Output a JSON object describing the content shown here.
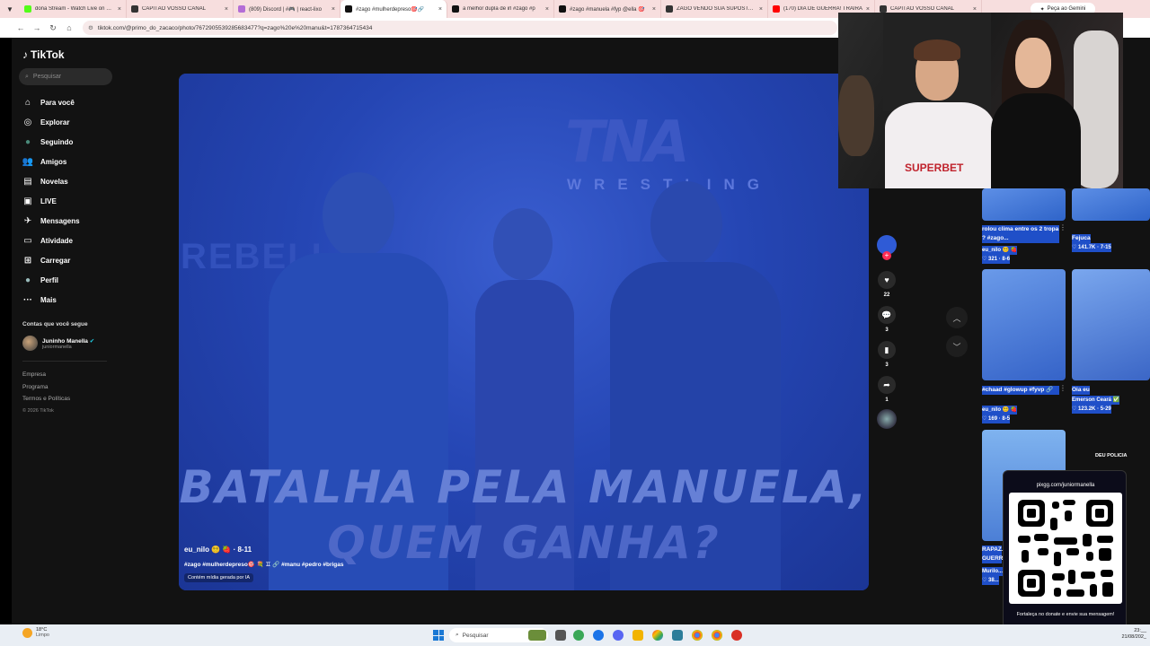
{
  "browser": {
    "tabs": [
      {
        "label": "dona Stream - Watch Live on K...",
        "color": "#53fc18",
        "active": false
      },
      {
        "label": "CAPITÃO VOSSO CANAL",
        "color": "#333333",
        "active": false
      },
      {
        "label": "(809) Discord | #🎮 | react-lixo",
        "color": "#b46dd6",
        "active": false
      },
      {
        "label": "#zago #mulherdepreso🎯🔗",
        "color": "#111111",
        "active": true
      },
      {
        "label": "a melhor dupla de irl #zago #p",
        "color": "#111111",
        "active": false
      },
      {
        "label": "#zago #manuela #fyp @ella 🎯",
        "color": "#111111",
        "active": false
      },
      {
        "label": "ZAGO VENDO SUA SUPOSTA N",
        "color": "#333333",
        "active": false
      },
      {
        "label": "(170) DIA DE GUERRA! TRAIRÁ",
        "color": "#ff0000",
        "active": false
      },
      {
        "label": "CAPITÃO VOSSO CANAL",
        "color": "#333333",
        "active": false
      }
    ],
    "gemini_label": "Peça ao Gemini",
    "url": "tiktok.com/@primo_do_zacaco/photo/7672905539285683477?q=zago%20e%20manu&t=1787364715434"
  },
  "tiktok": {
    "logo": "TikTok",
    "search_placeholder": "Pesquisar",
    "menu": [
      {
        "label": "Para você",
        "icon": "home-icon",
        "glyph": "⌂"
      },
      {
        "label": "Explorar",
        "icon": "compass-icon",
        "glyph": "◎"
      },
      {
        "label": "Seguindo",
        "icon": "following-avatar-icon",
        "glyph": "●"
      },
      {
        "label": "Amigos",
        "icon": "friends-icon",
        "glyph": "👥"
      },
      {
        "label": "Novelas",
        "icon": "novelas-icon",
        "glyph": "▤"
      },
      {
        "label": "LIVE",
        "icon": "live-icon",
        "glyph": "▣"
      },
      {
        "label": "Mensagens",
        "icon": "messages-icon",
        "glyph": "✈"
      },
      {
        "label": "Atividade",
        "icon": "activity-icon",
        "glyph": "▭"
      },
      {
        "label": "Carregar",
        "icon": "upload-icon",
        "glyph": "⊞"
      },
      {
        "label": "Perfil",
        "icon": "profile-icon",
        "glyph": "●"
      },
      {
        "label": "Mais",
        "icon": "more-icon",
        "glyph": "···"
      }
    ],
    "following_title": "Contas que você segue",
    "following": [
      {
        "name": "Juninho Manella",
        "handle": "juniormanella"
      }
    ],
    "footer": [
      "Empresa",
      "Programa",
      "Termos e Políticas"
    ],
    "copyright": "© 2026 TikTok"
  },
  "post": {
    "brand_logo": "TNA",
    "brand_sub": "WRESTLING",
    "banner_text": "REBELL",
    "headline_line1": "BATALHA PELA MANUELA,",
    "headline_line2": "QUEM GANHA?",
    "author": "eu_nilo 😵‍💫 🍓 · 8-11",
    "tags": "#zago #mulherdepreso🎯 💐 ♊ 🔗 #manu #pedro #brigas",
    "ai_label": "Contém mídia gerada por IA",
    "likes": "22",
    "comments": "3",
    "saves": "3",
    "shares": "1"
  },
  "feed": [
    {
      "title": "rolou clima entre os 2 tropa ? #zago...",
      "author": "eu_nilo 😵‍💫 🍓",
      "likes": "321",
      "date": "8-6",
      "col": 0
    },
    {
      "title": "Fejuca",
      "author": "",
      "likes": "141.7K",
      "date": "7-15",
      "col": 1
    },
    {
      "title": "#chaad #glowup #fyvp 🔗",
      "author": "eu_nilo 😵‍💫 🍓",
      "likes": "169",
      "date": "8-5",
      "col": 0
    },
    {
      "title": "Oia eu",
      "author": "Emerson Ceará ✅",
      "likes": "123.2K",
      "date": "5-29",
      "col": 1
    },
    {
      "title": "RAPAZ... GUERRI...",
      "author": "Murilo...",
      "likes": "38...",
      "date": "",
      "col": 0
    }
  ],
  "webcam": {
    "shirt_brand": "SUPERBET"
  },
  "overlay": {
    "tag": "DEU POLICIA",
    "url": "pixgg.com/juniormanella",
    "message": "Fortaleça no donate e envie sua mensagem!"
  },
  "taskbar": {
    "temp": "18°C",
    "weather": "Limpo",
    "search": "Pesquisar",
    "time": "23:__",
    "date": "21/08/202_"
  },
  "colors": {
    "accent": "#fe2c55",
    "video_blue": "#1f3fa6",
    "highlight": "#1f4fc8"
  }
}
